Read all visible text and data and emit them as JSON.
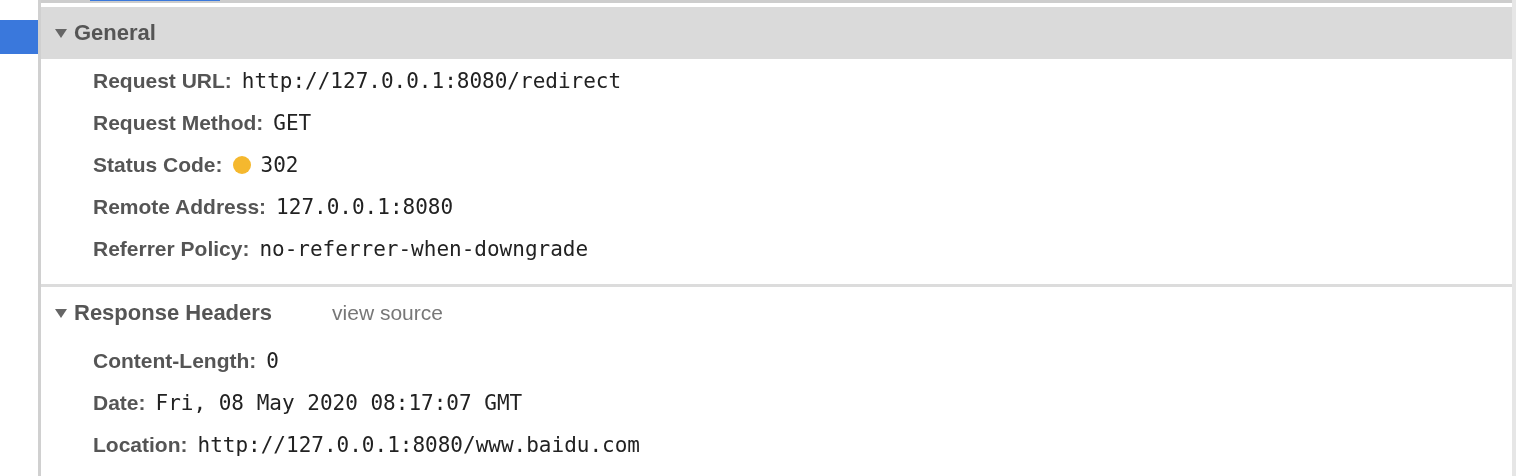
{
  "sections": [
    {
      "title": "General",
      "expanded": true,
      "header_highlighted": true,
      "fields": [
        {
          "label": "Request URL:",
          "value": "http://127.0.0.1:8080/redirect"
        },
        {
          "label": "Request Method:",
          "value": "GET"
        },
        {
          "label": "Status Code:",
          "value": "302",
          "color": "#f5b82e"
        },
        {
          "label": "Remote Address:",
          "value": "127.0.0.1:8080"
        },
        {
          "label": "Referrer Policy:",
          "value": "no-referrer-when-downgrade"
        }
      ]
    },
    {
      "title": "Response Headers",
      "expanded": true,
      "header_highlighted": false,
      "link": "view source",
      "fields": [
        {
          "label": "Content-Length:",
          "value": "0"
        },
        {
          "label": "Date:",
          "value": "Fri, 08 May 2020 08:17:07 GMT"
        },
        {
          "label": "Location:",
          "value": "http://127.0.0.1:8080/www.baidu.com"
        }
      ]
    }
  ]
}
